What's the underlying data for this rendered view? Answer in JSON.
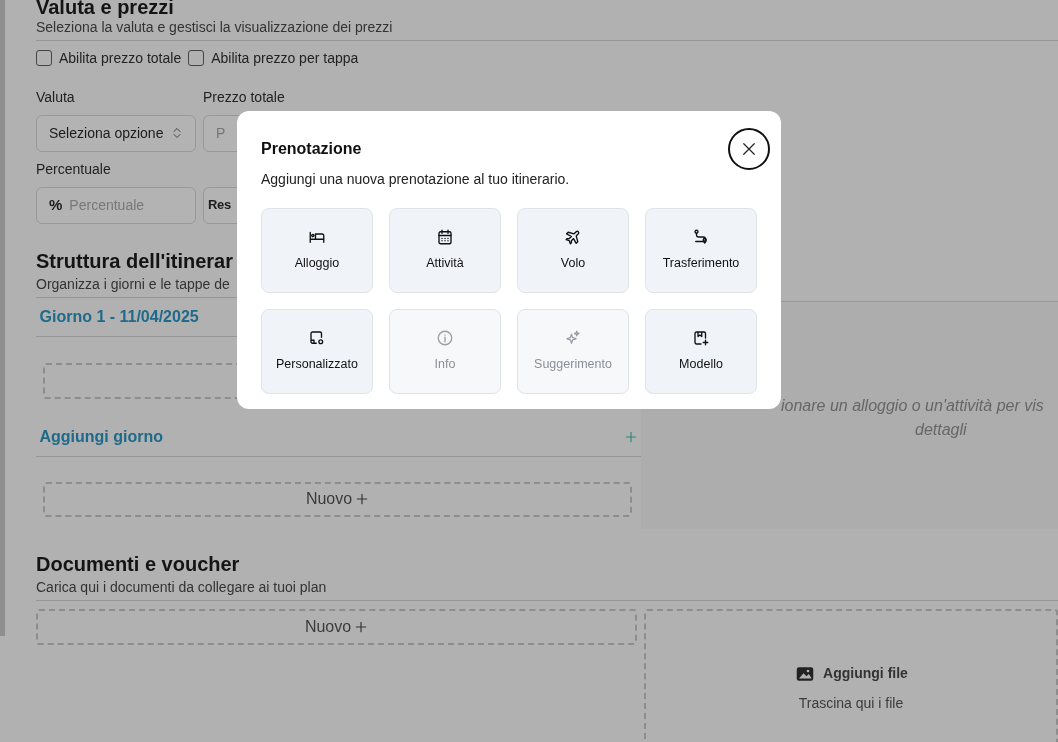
{
  "pricing": {
    "title": "Valuta e prezzi",
    "subtitle": "Seleziona la valuta e gestisci la visualizzazione dei prezzi",
    "toggles": [
      {
        "label": "Abilita prezzo totale",
        "checked": false
      },
      {
        "label": "Abilita prezzo per tappa",
        "checked": false
      }
    ],
    "currency": {
      "label": "Valuta",
      "value": "Seleziona opzione"
    },
    "total_price": {
      "label": "Prezzo totale",
      "placeholder": "P"
    },
    "percentage": {
      "label": "Percentuale",
      "prefix": "%",
      "placeholder": "Percentuale"
    },
    "field_4": {
      "value": "Res"
    }
  },
  "itinerary": {
    "title": "Struttura dell'itinerar",
    "subtitle": "Organizza i giorni e le tappe de",
    "days": [
      {
        "label": "Giorno 1 - 11/04/2025"
      }
    ],
    "add_day": "Aggiungi giorno",
    "new_button": "Nuovo",
    "details_hint": [
      "ionare un alloggio o un'attività per vis",
      "dettagli"
    ]
  },
  "documents": {
    "title": "Documenti e voucher",
    "subtitle": "Carica qui i documenti da collegare ai tuoi plan",
    "new_button": "Nuovo",
    "upload": {
      "title": "Aggiungi file",
      "hint": "Trascina qui i file"
    }
  },
  "modal": {
    "title": "Prenotazione",
    "subtitle": "Aggiungi una nuova prenotazione al tuo itinerario.",
    "options": [
      {
        "label": "Alloggio",
        "disabled": false
      },
      {
        "label": "Attività",
        "disabled": false
      },
      {
        "label": "Volo",
        "disabled": false
      },
      {
        "label": "Trasferimento",
        "disabled": false
      },
      {
        "label": "Personalizzato",
        "disabled": false
      },
      {
        "label": "Info",
        "disabled": true
      },
      {
        "label": "Suggerimento",
        "disabled": true
      },
      {
        "label": "Modello",
        "disabled": false
      }
    ]
  }
}
